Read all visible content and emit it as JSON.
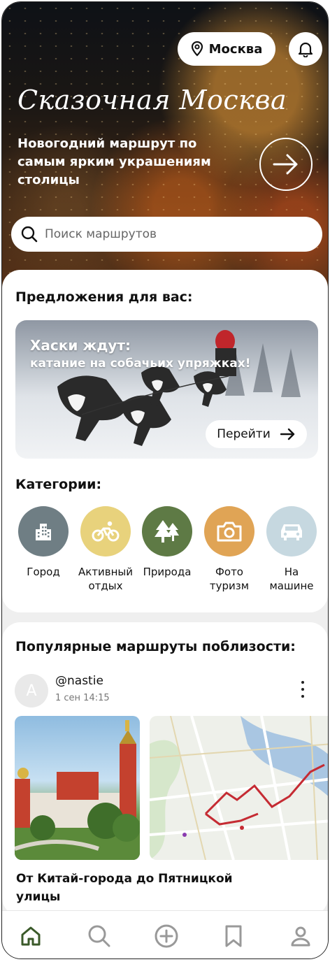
{
  "header": {
    "city": "Москва",
    "hero_title": "Сказочная Москва",
    "hero_subtitle": "Новогодний маршрут по самым ярким украшениям столицы"
  },
  "search": {
    "placeholder": "Поиск маршрутов"
  },
  "suggestions": {
    "title": "Предложения для вас:",
    "promo_title": "Хаски ждут:",
    "promo_subtitle": "катание на собачьих упряжках!",
    "button": "Перейти"
  },
  "categories": {
    "title": "Категории:",
    "items": [
      {
        "label": "Город",
        "icon": "building-icon",
        "color": "#6f7e84"
      },
      {
        "label": "Активный отдых",
        "icon": "bicycle-icon",
        "color": "#e8d27c"
      },
      {
        "label": "Природа",
        "icon": "trees-icon",
        "color": "#5e7a45"
      },
      {
        "label": "Фото туризм",
        "icon": "camera-icon",
        "color": "#e0a455"
      },
      {
        "label": "На машине",
        "icon": "car-icon",
        "color": "#c6d8e0"
      }
    ]
  },
  "popular": {
    "title": "Популярные маршруты поблизости:",
    "post": {
      "avatar_letter": "A",
      "user": "@nastie",
      "date": "1 сен 14:15",
      "route_title": "От Китай-города до Пятницкой улицы"
    }
  },
  "nav": {
    "items": [
      "home-icon",
      "search-icon",
      "add-icon",
      "bookmark-icon",
      "profile-icon"
    ],
    "active_color": "#3b5a2a"
  }
}
